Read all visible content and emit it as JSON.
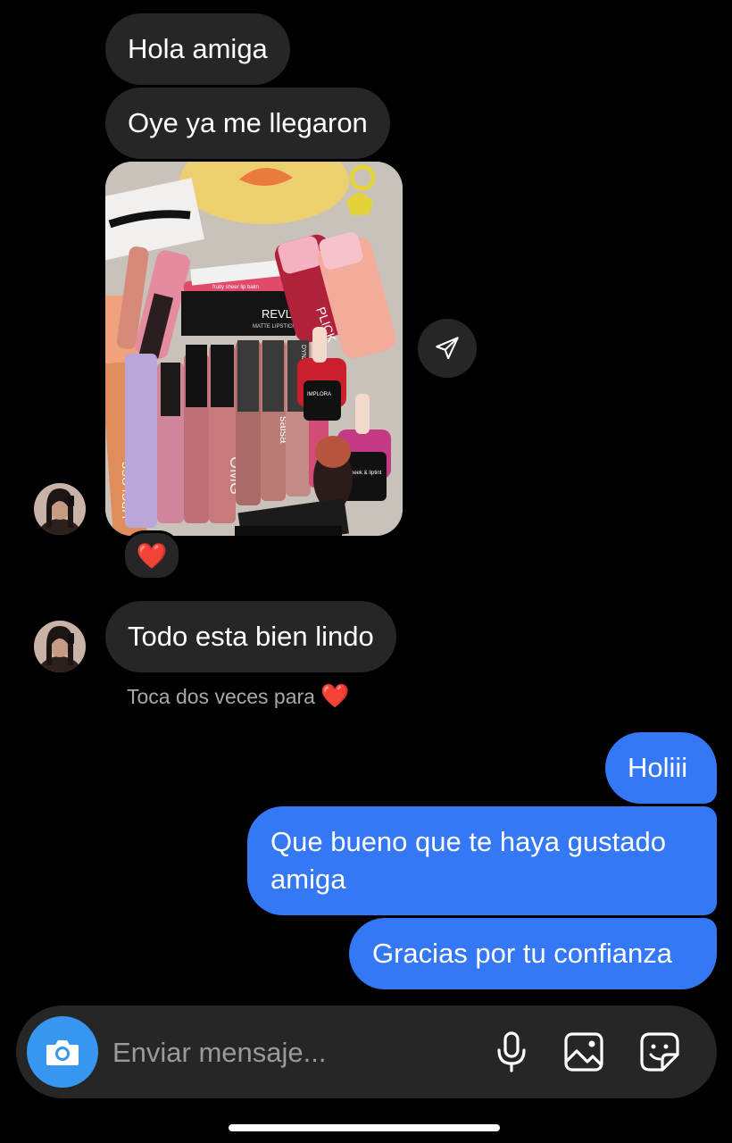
{
  "conversation": {
    "incoming": [
      {
        "text": "Hola amiga"
      },
      {
        "text": "Oye ya me llegaron"
      },
      {
        "text": "Todo esta bien lindo"
      }
    ],
    "photo_labels": [
      "REVLON",
      "MATTE LIPSTICK",
      "LIPGLOSS",
      "OMG",
      "salsa",
      "DYNAMATTE",
      "IMPLORA",
      "cheek & liptint",
      "PLICK",
      "fruity sheer lip balm"
    ],
    "reaction": "❤️",
    "hint": {
      "text": "Toca dos veces para",
      "heart": "❤️"
    },
    "outgoing": [
      {
        "text": "Holiii"
      },
      {
        "line1": "Que bueno que te haya gustado",
        "line2": "amiga"
      },
      {
        "text": "Gracias por tu confianza"
      }
    ]
  },
  "composer": {
    "placeholder": "Enviar mensaje...",
    "icons": [
      "camera-icon",
      "microphone-icon",
      "gallery-icon",
      "sticker-icon"
    ]
  },
  "icons": {
    "share": "paper-plane-icon"
  },
  "colors": {
    "background": "#000000",
    "incoming_bubble": "#262626",
    "outgoing_bubble": "#3478f6",
    "camera_button": "#3797f0",
    "heart": "#ed2f45"
  }
}
